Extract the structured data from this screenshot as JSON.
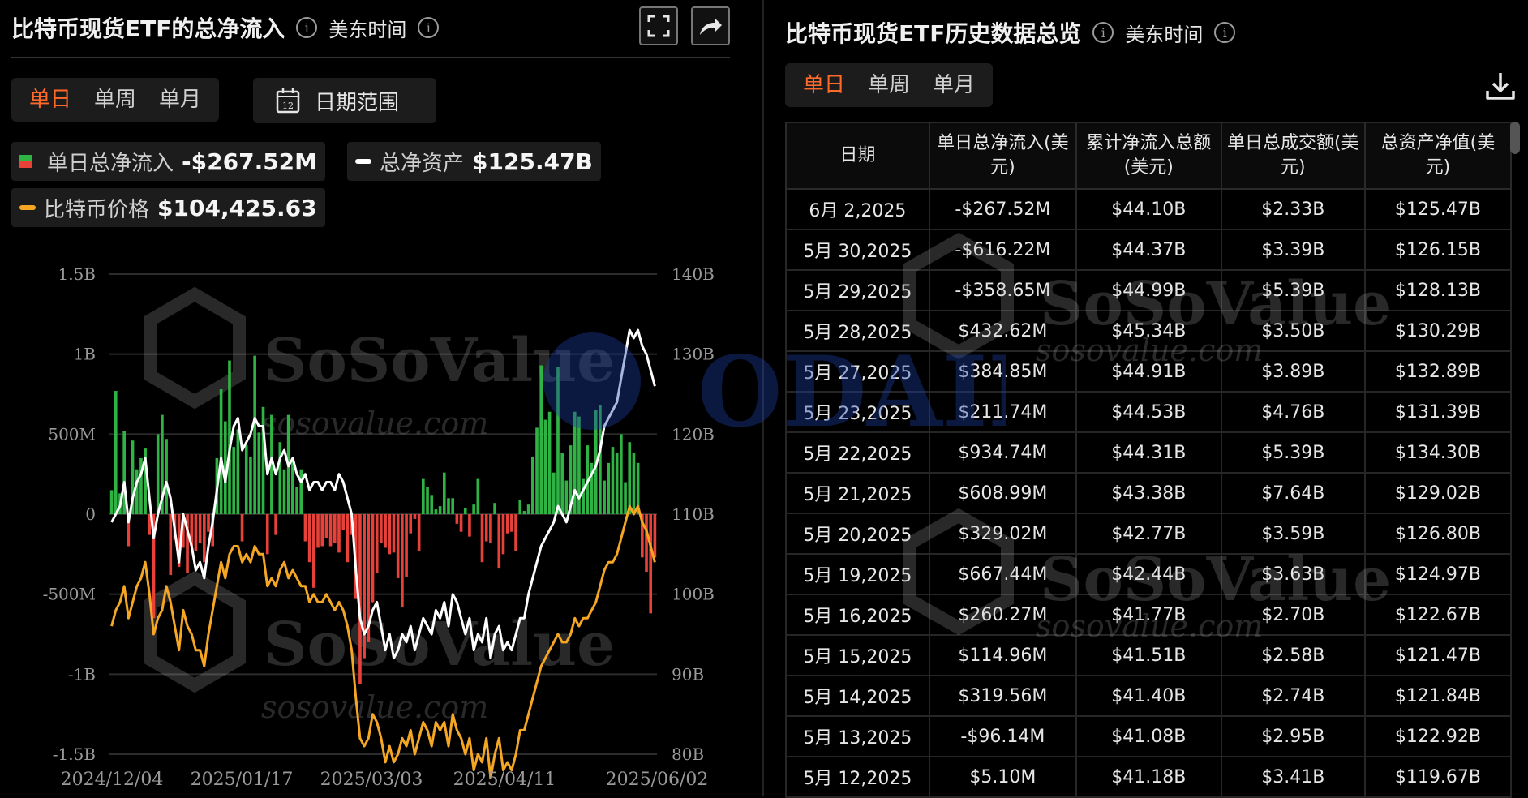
{
  "left": {
    "title": "比特币现货ETF的总净流入",
    "timezone": "美东时间",
    "tabs": [
      "单日",
      "单周",
      "单月"
    ],
    "active_tab": "单日",
    "date_range_label": "日期范围",
    "calendar_day": "12",
    "legend": [
      {
        "label": "单日总净流入",
        "value": "-$267.52M"
      },
      {
        "label": "总净资产",
        "value": "$125.47B"
      },
      {
        "label": "比特币价格",
        "value": "$104,425.63"
      }
    ]
  },
  "right": {
    "title": "比特币现货ETF历史数据总览",
    "timezone": "美东时间",
    "tabs": [
      "单日",
      "单周",
      "单月"
    ],
    "active_tab": "单日",
    "columns": [
      "日期",
      "单日总净流入(美元)",
      "累计净流入总额(美元)",
      "单日总成交额(美元)",
      "总资产净值(美元)"
    ],
    "rows": [
      {
        "date": "6月 2,2025",
        "flow": "-$267.52M",
        "sign": "neg",
        "cum": "$44.10B",
        "vol": "$2.33B",
        "nav": "$125.47B"
      },
      {
        "date": "5月 30,2025",
        "flow": "-$616.22M",
        "sign": "neg",
        "cum": "$44.37B",
        "vol": "$3.39B",
        "nav": "$126.15B"
      },
      {
        "date": "5月 29,2025",
        "flow": "-$358.65M",
        "sign": "neg",
        "cum": "$44.99B",
        "vol": "$5.39B",
        "nav": "$128.13B"
      },
      {
        "date": "5月 28,2025",
        "flow": "$432.62M",
        "sign": "pos",
        "cum": "$45.34B",
        "vol": "$3.50B",
        "nav": "$130.29B"
      },
      {
        "date": "5月 27,2025",
        "flow": "$384.85M",
        "sign": "pos",
        "cum": "$44.91B",
        "vol": "$3.89B",
        "nav": "$132.89B"
      },
      {
        "date": "5月 23,2025",
        "flow": "$211.74M",
        "sign": "pos",
        "cum": "$44.53B",
        "vol": "$4.76B",
        "nav": "$131.39B"
      },
      {
        "date": "5月 22,2025",
        "flow": "$934.74M",
        "sign": "pos",
        "cum": "$44.31B",
        "vol": "$5.39B",
        "nav": "$134.30B"
      },
      {
        "date": "5月 21,2025",
        "flow": "$608.99M",
        "sign": "pos",
        "cum": "$43.38B",
        "vol": "$7.64B",
        "nav": "$129.02B"
      },
      {
        "date": "5月 20,2025",
        "flow": "$329.02M",
        "sign": "pos",
        "cum": "$42.77B",
        "vol": "$3.59B",
        "nav": "$126.80B"
      },
      {
        "date": "5月 19,2025",
        "flow": "$667.44M",
        "sign": "pos",
        "cum": "$42.44B",
        "vol": "$3.63B",
        "nav": "$124.97B"
      },
      {
        "date": "5月 16,2025",
        "flow": "$260.27M",
        "sign": "pos",
        "cum": "$41.77B",
        "vol": "$2.70B",
        "nav": "$122.67B"
      },
      {
        "date": "5月 15,2025",
        "flow": "$114.96M",
        "sign": "pos",
        "cum": "$41.51B",
        "vol": "$2.58B",
        "nav": "$121.47B"
      },
      {
        "date": "5月 14,2025",
        "flow": "$319.56M",
        "sign": "pos",
        "cum": "$41.40B",
        "vol": "$2.74B",
        "nav": "$121.84B"
      },
      {
        "date": "5月 13,2025",
        "flow": "-$96.14M",
        "sign": "neg",
        "cum": "$41.08B",
        "vol": "$2.95B",
        "nav": "$122.92B"
      },
      {
        "date": "5月 12,2025",
        "flow": "$5.10M",
        "sign": "pos",
        "cum": "$41.18B",
        "vol": "$3.41B",
        "nav": "$119.67B"
      }
    ]
  },
  "watermarks": {
    "brand": "SoSoValue",
    "site": "sosovalue.com",
    "odaily": "ODAILY"
  },
  "colors": {
    "accent": "#ff6a2a",
    "inflow": "#2fb344",
    "outflow": "#e8413a",
    "net_assets_line": "#ffffff",
    "btc_price_line": "#f5a623"
  },
  "chart_data": {
    "type": "bar",
    "x_ticks": [
      "2024/12/04",
      "2025/01/17",
      "2025/03/03",
      "2025/04/11",
      "2025/06/02"
    ],
    "y_left": {
      "range": [
        -1500000000,
        1500000000
      ],
      "ticks": [
        -1500000000,
        -1000000000,
        -500000000,
        0,
        500000000,
        1000000000,
        1500000000
      ],
      "tick_labels": [
        "-1.5B",
        "-1B",
        "-500M",
        "0",
        "500M",
        "1B",
        "1.5B"
      ]
    },
    "y_right": {
      "range": [
        80,
        140
      ],
      "ticks": [
        80,
        90,
        100,
        110,
        120,
        130,
        140
      ],
      "tick_labels": [
        "80B",
        "90B",
        "100B",
        "110B",
        "120B",
        "130B",
        "140B"
      ]
    },
    "grid": true,
    "series": [
      {
        "name": "单日总净流入",
        "type": "bar",
        "axis": "left",
        "values_millions": [
          150,
          770,
          130,
          520,
          -200,
          460,
          280,
          350,
          410,
          -130,
          -650,
          500,
          620,
          470,
          -380,
          -160,
          -330,
          -210,
          -370,
          -200,
          -230,
          -180,
          -300,
          -110,
          -200,
          350,
          780,
          580,
          960,
          420,
          530,
          -170,
          430,
          360,
          990,
          510,
          670,
          -250,
          620,
          -130,
          450,
          280,
          620,
          330,
          170,
          280,
          -170,
          -300,
          -460,
          -210,
          -200,
          -150,
          -200,
          -180,
          -240,
          -100,
          -300,
          -130,
          -530,
          -1060,
          -900,
          -800,
          -550,
          -370,
          -180,
          -210,
          -250,
          -240,
          -400,
          -580,
          -390,
          -120,
          -30,
          -230,
          220,
          170,
          120,
          30,
          50,
          260,
          100,
          100,
          -60,
          -110,
          40,
          -140,
          60,
          220,
          -300,
          -170,
          -180,
          70,
          -340,
          -250,
          -120,
          -110,
          -230,
          90,
          20,
          60,
          360,
          540,
          930,
          590,
          640,
          260,
          920,
          380,
          210,
          430,
          640,
          610,
          220,
          430,
          320,
          650,
          680,
          210,
          320,
          420,
          380,
          500,
          200,
          450,
          380,
          320,
          -270,
          -360,
          -620,
          -270
        ]
      },
      {
        "name": "总净资产",
        "type": "line",
        "axis": "right",
        "values_billions": [
          109,
          110,
          111,
          114,
          109,
          112,
          114,
          115,
          117,
          112,
          107,
          110,
          112,
          114,
          112,
          108,
          104,
          110,
          108,
          106,
          103,
          104,
          102,
          106,
          109,
          113,
          117,
          114,
          118,
          121,
          122,
          118,
          119,
          120,
          122,
          121,
          121,
          115,
          117,
          115,
          117,
          118,
          116,
          117,
          115,
          114,
          115,
          113,
          114,
          114,
          113,
          114,
          114,
          113,
          115,
          114,
          112,
          110,
          103,
          97,
          95,
          96,
          98,
          99,
          96,
          93,
          95,
          92,
          93,
          95,
          94,
          96,
          93,
          95,
          97,
          96,
          95,
          98,
          97,
          99,
          96,
          100,
          99,
          97,
          95,
          97,
          93,
          95,
          94,
          97,
          92,
          95,
          96,
          93,
          94,
          93,
          95,
          97,
          97,
          100,
          102,
          104,
          106,
          107,
          108,
          109,
          111,
          110,
          109,
          111,
          113,
          112,
          113,
          114,
          115,
          116,
          118,
          121,
          122,
          123,
          124,
          127,
          130,
          133,
          132,
          133,
          131,
          130,
          128,
          126
        ]
      },
      {
        "name": "比特币价格",
        "type": "line",
        "axis": "right",
        "values_thousands": [
          96,
          98,
          99,
          101,
          97,
          99,
          101,
          102,
          104,
          100,
          95,
          97,
          98,
          101,
          99,
          96,
          93,
          98,
          96,
          95,
          93,
          93,
          91,
          95,
          98,
          101,
          104,
          102,
          105,
          106,
          106,
          104,
          105,
          104,
          106,
          105,
          105,
          101,
          102,
          101,
          103,
          104,
          102,
          103,
          102,
          101,
          101,
          99,
          100,
          99,
          99,
          100,
          99,
          98,
          99,
          98,
          96,
          93,
          87,
          82,
          81,
          82,
          85,
          84,
          82,
          79,
          81,
          79,
          80,
          82,
          81,
          83,
          80,
          82,
          84,
          83,
          81,
          84,
          83,
          84,
          81,
          85,
          83,
          82,
          80,
          82,
          78,
          80,
          79,
          82,
          77,
          80,
          82,
          78,
          79,
          78,
          80,
          83,
          83,
          85,
          87,
          89,
          91,
          92,
          93,
          94,
          95,
          94,
          94,
          95,
          97,
          96,
          97,
          97,
          98,
          99,
          101,
          103,
          104,
          104,
          105,
          107,
          109,
          111,
          110,
          111,
          109,
          108,
          106,
          104
        ]
      }
    ]
  }
}
